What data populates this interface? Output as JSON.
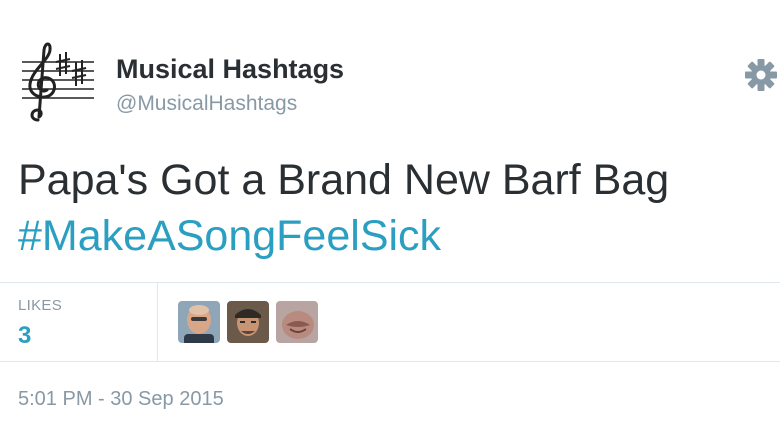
{
  "user": {
    "display_name": "Musical Hashtags",
    "handle": "@MusicalHashtags",
    "avatar_icon": "treble-clef-staff-icon"
  },
  "actions": {
    "settings_icon": "gear-icon"
  },
  "tweet": {
    "text_line1": "Papa's Got a Brand New Barf Bag",
    "hashtag": "#MakeASongFeelSick"
  },
  "stats": {
    "likes_label": "LIKES",
    "likes_count": "3"
  },
  "likers": [
    {
      "name": "liker-avatar-1"
    },
    {
      "name": "liker-avatar-2"
    },
    {
      "name": "liker-avatar-3"
    }
  ],
  "timestamp": "5:01 PM - 30 Sep 2015",
  "colors": {
    "link": "#2b9fc1",
    "text": "#292f33",
    "muted": "#8899a6",
    "divider": "#e1e8ed"
  }
}
